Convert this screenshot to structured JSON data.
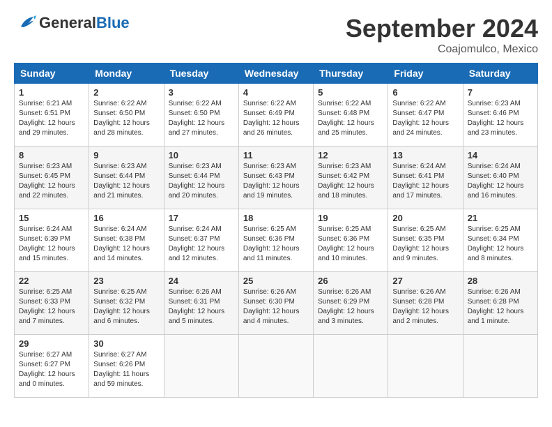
{
  "header": {
    "logo_general": "General",
    "logo_blue": "Blue",
    "month_title": "September 2024",
    "location": "Coajomulco, Mexico"
  },
  "days_of_week": [
    "Sunday",
    "Monday",
    "Tuesday",
    "Wednesday",
    "Thursday",
    "Friday",
    "Saturday"
  ],
  "weeks": [
    [
      {
        "day": "1",
        "sunrise": "Sunrise: 6:21 AM",
        "sunset": "Sunset: 6:51 PM",
        "daylight": "Daylight: 12 hours and 29 minutes."
      },
      {
        "day": "2",
        "sunrise": "Sunrise: 6:22 AM",
        "sunset": "Sunset: 6:50 PM",
        "daylight": "Daylight: 12 hours and 28 minutes."
      },
      {
        "day": "3",
        "sunrise": "Sunrise: 6:22 AM",
        "sunset": "Sunset: 6:50 PM",
        "daylight": "Daylight: 12 hours and 27 minutes."
      },
      {
        "day": "4",
        "sunrise": "Sunrise: 6:22 AM",
        "sunset": "Sunset: 6:49 PM",
        "daylight": "Daylight: 12 hours and 26 minutes."
      },
      {
        "day": "5",
        "sunrise": "Sunrise: 6:22 AM",
        "sunset": "Sunset: 6:48 PM",
        "daylight": "Daylight: 12 hours and 25 minutes."
      },
      {
        "day": "6",
        "sunrise": "Sunrise: 6:22 AM",
        "sunset": "Sunset: 6:47 PM",
        "daylight": "Daylight: 12 hours and 24 minutes."
      },
      {
        "day": "7",
        "sunrise": "Sunrise: 6:23 AM",
        "sunset": "Sunset: 6:46 PM",
        "daylight": "Daylight: 12 hours and 23 minutes."
      }
    ],
    [
      {
        "day": "8",
        "sunrise": "Sunrise: 6:23 AM",
        "sunset": "Sunset: 6:45 PM",
        "daylight": "Daylight: 12 hours and 22 minutes."
      },
      {
        "day": "9",
        "sunrise": "Sunrise: 6:23 AM",
        "sunset": "Sunset: 6:44 PM",
        "daylight": "Daylight: 12 hours and 21 minutes."
      },
      {
        "day": "10",
        "sunrise": "Sunrise: 6:23 AM",
        "sunset": "Sunset: 6:44 PM",
        "daylight": "Daylight: 12 hours and 20 minutes."
      },
      {
        "day": "11",
        "sunrise": "Sunrise: 6:23 AM",
        "sunset": "Sunset: 6:43 PM",
        "daylight": "Daylight: 12 hours and 19 minutes."
      },
      {
        "day": "12",
        "sunrise": "Sunrise: 6:23 AM",
        "sunset": "Sunset: 6:42 PM",
        "daylight": "Daylight: 12 hours and 18 minutes."
      },
      {
        "day": "13",
        "sunrise": "Sunrise: 6:24 AM",
        "sunset": "Sunset: 6:41 PM",
        "daylight": "Daylight: 12 hours and 17 minutes."
      },
      {
        "day": "14",
        "sunrise": "Sunrise: 6:24 AM",
        "sunset": "Sunset: 6:40 PM",
        "daylight": "Daylight: 12 hours and 16 minutes."
      }
    ],
    [
      {
        "day": "15",
        "sunrise": "Sunrise: 6:24 AM",
        "sunset": "Sunset: 6:39 PM",
        "daylight": "Daylight: 12 hours and 15 minutes."
      },
      {
        "day": "16",
        "sunrise": "Sunrise: 6:24 AM",
        "sunset": "Sunset: 6:38 PM",
        "daylight": "Daylight: 12 hours and 14 minutes."
      },
      {
        "day": "17",
        "sunrise": "Sunrise: 6:24 AM",
        "sunset": "Sunset: 6:37 PM",
        "daylight": "Daylight: 12 hours and 12 minutes."
      },
      {
        "day": "18",
        "sunrise": "Sunrise: 6:25 AM",
        "sunset": "Sunset: 6:36 PM",
        "daylight": "Daylight: 12 hours and 11 minutes."
      },
      {
        "day": "19",
        "sunrise": "Sunrise: 6:25 AM",
        "sunset": "Sunset: 6:36 PM",
        "daylight": "Daylight: 12 hours and 10 minutes."
      },
      {
        "day": "20",
        "sunrise": "Sunrise: 6:25 AM",
        "sunset": "Sunset: 6:35 PM",
        "daylight": "Daylight: 12 hours and 9 minutes."
      },
      {
        "day": "21",
        "sunrise": "Sunrise: 6:25 AM",
        "sunset": "Sunset: 6:34 PM",
        "daylight": "Daylight: 12 hours and 8 minutes."
      }
    ],
    [
      {
        "day": "22",
        "sunrise": "Sunrise: 6:25 AM",
        "sunset": "Sunset: 6:33 PM",
        "daylight": "Daylight: 12 hours and 7 minutes."
      },
      {
        "day": "23",
        "sunrise": "Sunrise: 6:25 AM",
        "sunset": "Sunset: 6:32 PM",
        "daylight": "Daylight: 12 hours and 6 minutes."
      },
      {
        "day": "24",
        "sunrise": "Sunrise: 6:26 AM",
        "sunset": "Sunset: 6:31 PM",
        "daylight": "Daylight: 12 hours and 5 minutes."
      },
      {
        "day": "25",
        "sunrise": "Sunrise: 6:26 AM",
        "sunset": "Sunset: 6:30 PM",
        "daylight": "Daylight: 12 hours and 4 minutes."
      },
      {
        "day": "26",
        "sunrise": "Sunrise: 6:26 AM",
        "sunset": "Sunset: 6:29 PM",
        "daylight": "Daylight: 12 hours and 3 minutes."
      },
      {
        "day": "27",
        "sunrise": "Sunrise: 6:26 AM",
        "sunset": "Sunset: 6:28 PM",
        "daylight": "Daylight: 12 hours and 2 minutes."
      },
      {
        "day": "28",
        "sunrise": "Sunrise: 6:26 AM",
        "sunset": "Sunset: 6:28 PM",
        "daylight": "Daylight: 12 hours and 1 minute."
      }
    ],
    [
      {
        "day": "29",
        "sunrise": "Sunrise: 6:27 AM",
        "sunset": "Sunset: 6:27 PM",
        "daylight": "Daylight: 12 hours and 0 minutes."
      },
      {
        "day": "30",
        "sunrise": "Sunrise: 6:27 AM",
        "sunset": "Sunset: 6:26 PM",
        "daylight": "Daylight: 11 hours and 59 minutes."
      },
      null,
      null,
      null,
      null,
      null
    ]
  ]
}
